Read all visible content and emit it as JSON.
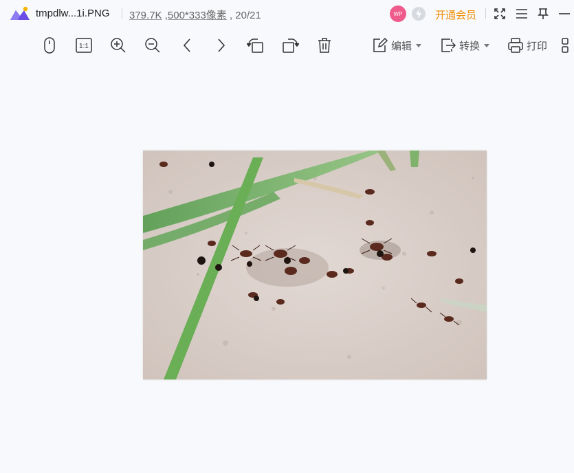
{
  "title_bar": {
    "file_name": "tmpdlw...1i.PNG",
    "file_size": "379.7K",
    "dimensions": "500*333像素",
    "page_counter": ", 20/21",
    "avatar_text": "WP",
    "vip_label": "开通会员"
  },
  "toolbar": {
    "edit_label": "编辑",
    "convert_label": "转换",
    "print_label": "打印"
  },
  "image": {
    "description_icon": "photo-ants-on-sand"
  },
  "colors": {
    "background": "#f7f9fc",
    "vip": "#f08c00",
    "avatar": "#ef5b8a",
    "logo_purple": "#6b4de6",
    "logo_yellow": "#f5b400"
  }
}
